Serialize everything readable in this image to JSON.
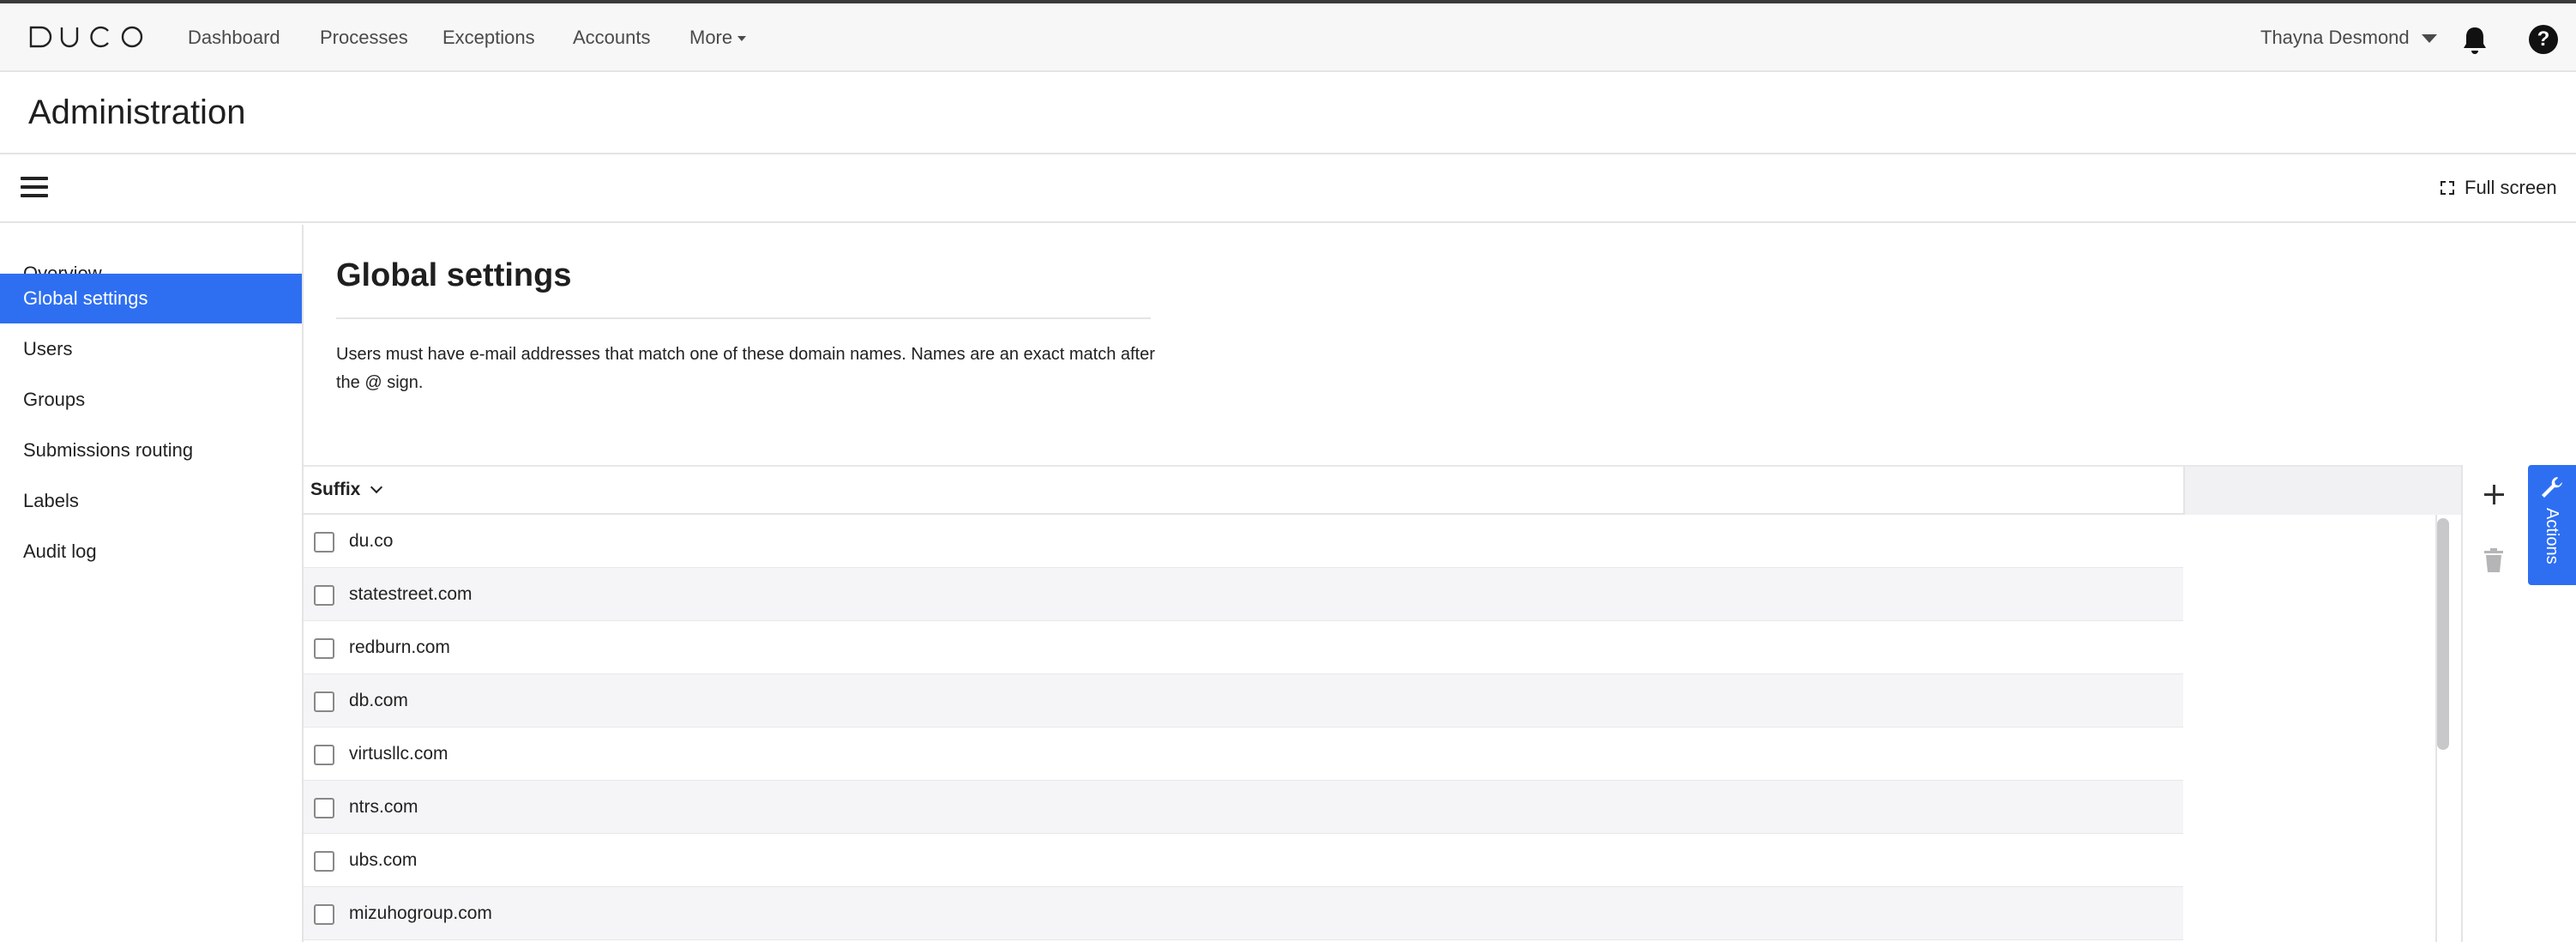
{
  "app": {
    "logo_text": "DUCO",
    "nav": [
      {
        "label": "Dashboard"
      },
      {
        "label": "Processes"
      },
      {
        "label": "Exceptions"
      },
      {
        "label": "Accounts"
      },
      {
        "label": "More"
      }
    ],
    "user_name": "Thayna Desmond",
    "help_symbol": "?"
  },
  "page": {
    "title": "Administration"
  },
  "toolbar": {
    "fullscreen_label": "Full screen"
  },
  "sidebar": {
    "items": [
      {
        "label": "Overview",
        "active": false
      },
      {
        "label": "Global settings",
        "active": true
      },
      {
        "label": "Users",
        "active": false
      },
      {
        "label": "Groups",
        "active": false
      },
      {
        "label": "Submissions routing",
        "active": false
      },
      {
        "label": "Labels",
        "active": false
      },
      {
        "label": "Audit log",
        "active": false
      }
    ]
  },
  "main": {
    "section_title": "Global settings",
    "description": "Users must have e-mail addresses that match one of these domain names. Names are an exact match after the @ sign.",
    "table": {
      "column_header": "Suffix",
      "rows": [
        {
          "suffix": "du.co",
          "checked": false
        },
        {
          "suffix": "statestreet.com",
          "checked": false
        },
        {
          "suffix": "redburn.com",
          "checked": false
        },
        {
          "suffix": "db.com",
          "checked": false
        },
        {
          "suffix": "virtusllc.com",
          "checked": false
        },
        {
          "suffix": "ntrs.com",
          "checked": false
        },
        {
          "suffix": "ubs.com",
          "checked": false
        },
        {
          "suffix": "mizuhogroup.com",
          "checked": false
        }
      ]
    }
  },
  "actions_panel": {
    "tab_label": "Actions",
    "tools": [
      {
        "icon": "plus-icon"
      },
      {
        "icon": "trash-icon"
      }
    ]
  },
  "colors": {
    "accent": "#2e6ff2",
    "topbar_bg": "#f7f7f8",
    "row_alt": "#f5f5f7"
  }
}
